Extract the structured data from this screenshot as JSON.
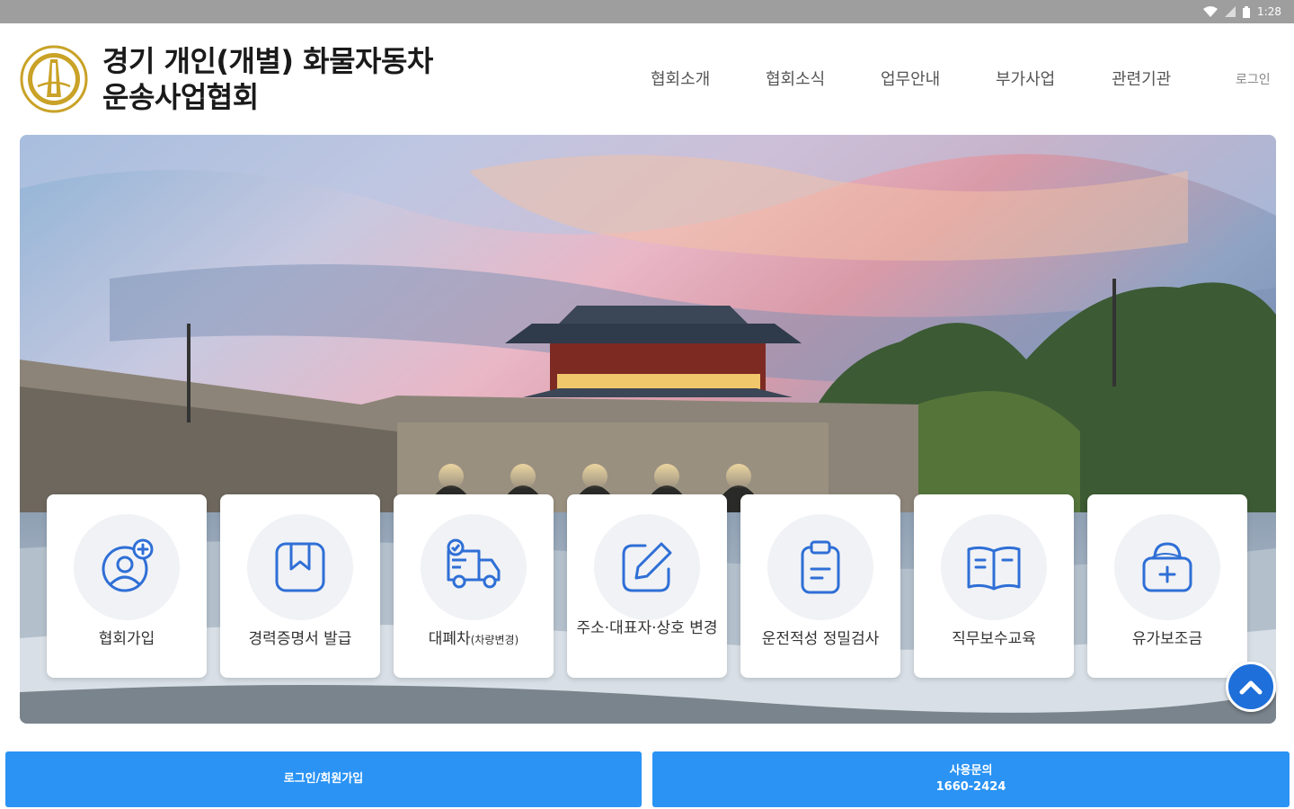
{
  "status_bar": {
    "time": "1:28"
  },
  "header": {
    "org_name_line1": "경기 개인(개별) 화물자동차",
    "org_name_line2": "운송사업협회",
    "nav": [
      {
        "label": "협회소개"
      },
      {
        "label": "협회소식"
      },
      {
        "label": "업무안내"
      },
      {
        "label": "부가사업"
      },
      {
        "label": "관련기관"
      }
    ],
    "login_label": "로그인"
  },
  "services": [
    {
      "label": "협회가입",
      "icon": "user-add-icon"
    },
    {
      "label": "경력증명서 발급",
      "icon": "bookmark-icon"
    },
    {
      "label": "대폐차",
      "sub": "(차량변경)",
      "icon": "truck-check-icon"
    },
    {
      "label": "주소·대표자·상호 변경",
      "icon": "edit-icon"
    },
    {
      "label": "운전적성 정밀검사",
      "icon": "clipboard-icon"
    },
    {
      "label": "직무보수교육",
      "icon": "book-open-icon"
    },
    {
      "label": "유가보조금",
      "icon": "medical-bag-icon"
    }
  ],
  "bottom": {
    "login_button": "로그인/회원가입",
    "inquiry_label": "사용문의",
    "inquiry_phone": "1660-2424"
  },
  "colors": {
    "accent": "#2a93f4",
    "scroll_top": "#1e6fd9",
    "icon_blue": "#2f6fd6",
    "logo_gold": "#c9a227"
  }
}
